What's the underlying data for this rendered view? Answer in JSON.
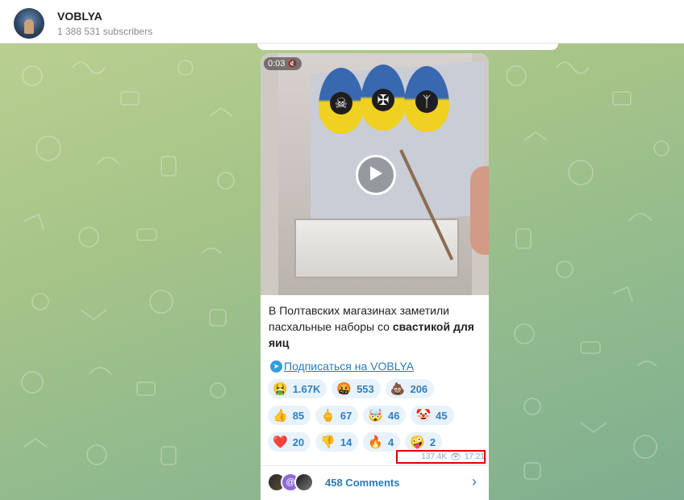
{
  "header": {
    "channel_name": "VOBLYA",
    "subscribers": "1 388 531 subscribers"
  },
  "post": {
    "video": {
      "duration": "0:03",
      "mute_icon": "mute-icon"
    },
    "text_part1": "В Полтавских магазинах заметили пасхальные наборы со ",
    "text_bold": "свастикой для яиц",
    "subscribe_link": "Подписаться на VOBLYA",
    "reactions": [
      [
        {
          "emoji": "🤮",
          "count": "1.67K"
        },
        {
          "emoji": "🤬",
          "count": "553"
        },
        {
          "emoji": "💩",
          "count": "206"
        }
      ],
      [
        {
          "emoji": "👍",
          "count": "85"
        },
        {
          "emoji": "🖕",
          "count": "67"
        },
        {
          "emoji": "🤯",
          "count": "46"
        },
        {
          "emoji": "🤡",
          "count": "45"
        }
      ],
      [
        {
          "emoji": "❤️",
          "count": "20"
        },
        {
          "emoji": "👎",
          "count": "14"
        },
        {
          "emoji": "🔥",
          "count": "4"
        },
        {
          "emoji": "🤪",
          "count": "2"
        }
      ]
    ],
    "views": "137.4K",
    "time": "17:21",
    "comments_label": "458 Comments"
  },
  "colors": {
    "accent": "#2a7ab8",
    "highlight_box": "#e00000",
    "reaction_bg": "#e8f2fb"
  }
}
